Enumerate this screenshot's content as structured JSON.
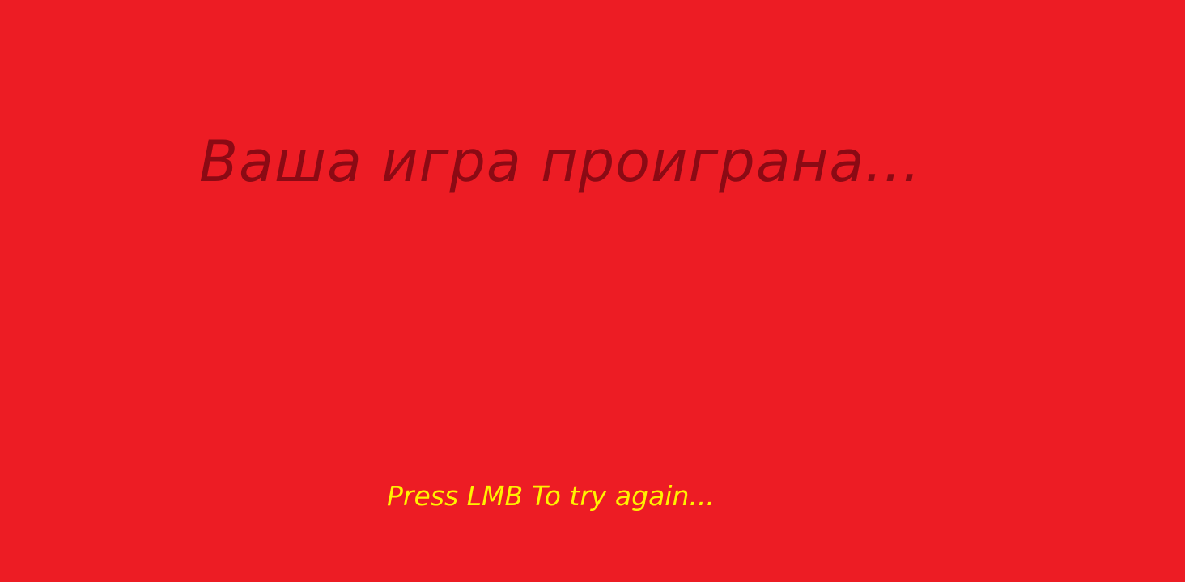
{
  "game_over": {
    "title": "Ваша игра проиграна...",
    "retry_hint": "Press LMB To try again..."
  },
  "colors": {
    "background": "#ED1C24",
    "title": "#8B0A14",
    "hint": "#FFF200"
  }
}
